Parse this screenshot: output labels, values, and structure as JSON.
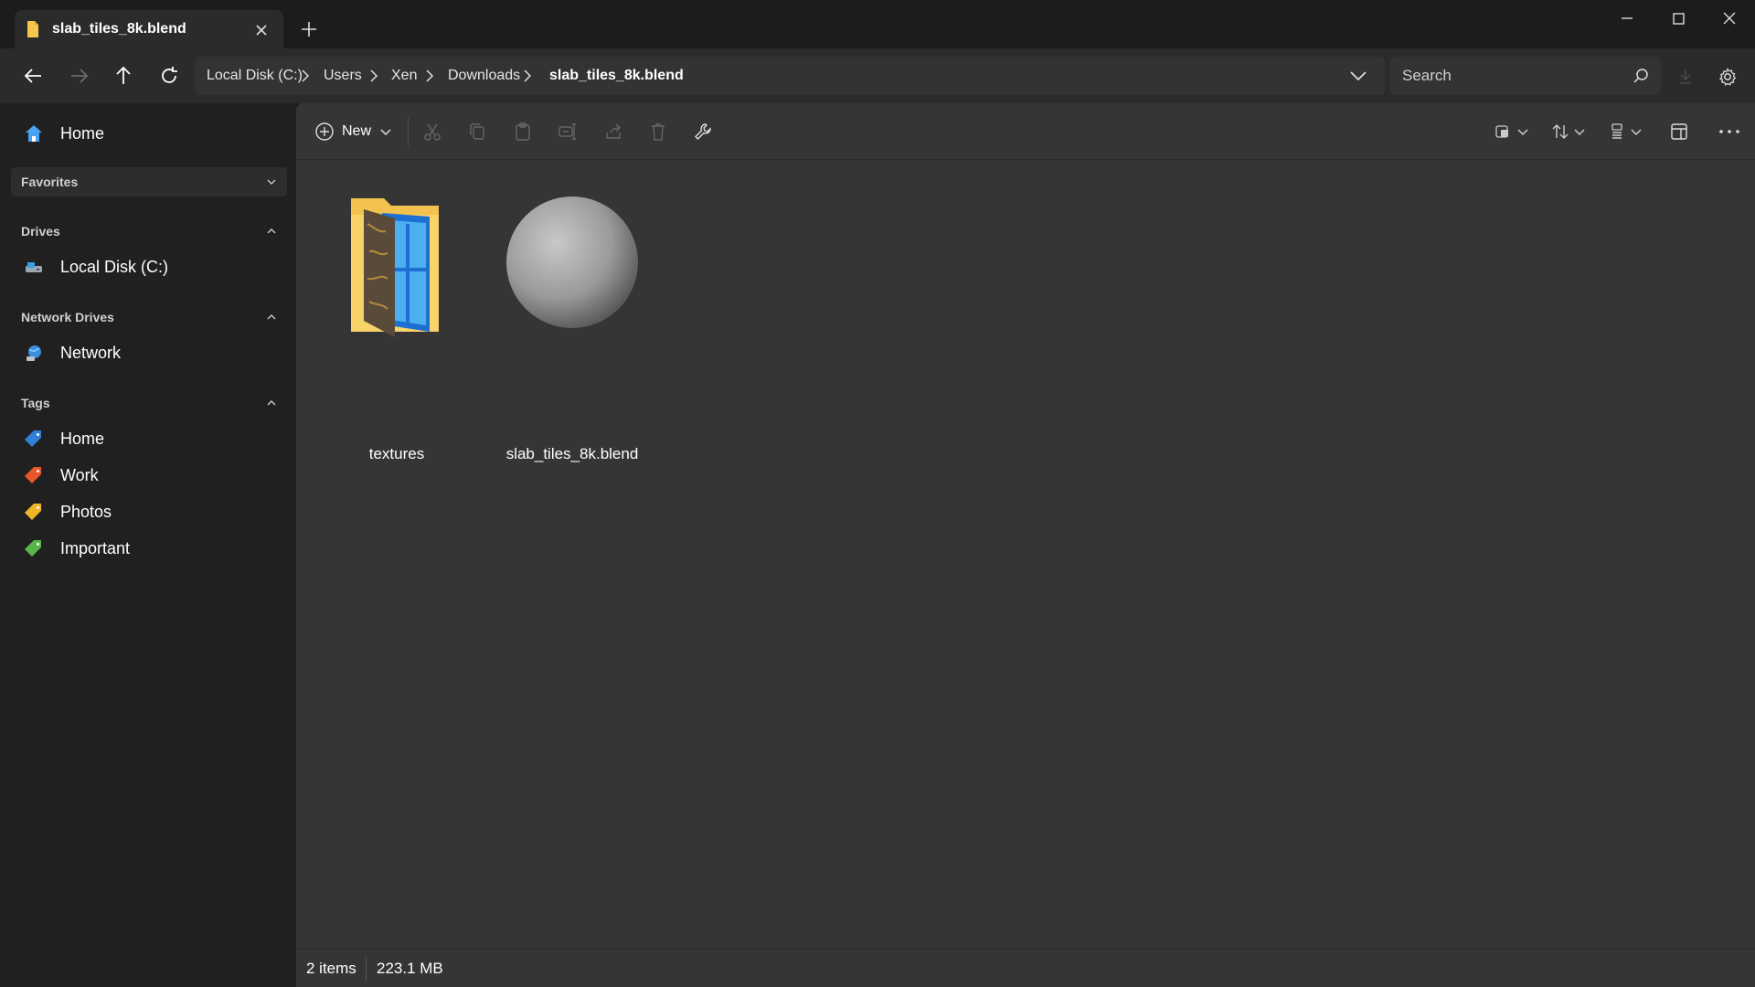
{
  "window": {
    "tab_title": "slab_tiles_8k.blend"
  },
  "breadcrumb": {
    "items": [
      "Local Disk (C:)",
      "Users",
      "Xen",
      "Downloads",
      "slab_tiles_8k.blend"
    ]
  },
  "search": {
    "placeholder": "Search"
  },
  "sidebar": {
    "home_label": "Home",
    "favorites_title": "Favorites",
    "drives_title": "Drives",
    "drives": [
      {
        "label": "Local Disk (C:)",
        "icon": "drive-icon"
      }
    ],
    "network_title": "Network Drives",
    "network": [
      {
        "label": "Network",
        "icon": "network-icon"
      }
    ],
    "tags_title": "Tags",
    "tags": [
      {
        "label": "Home",
        "color": "#2f7fd8",
        "icon": "tag-icon"
      },
      {
        "label": "Work",
        "color": "#e8572a",
        "icon": "tag-icon"
      },
      {
        "label": "Photos",
        "color": "#f0b429",
        "icon": "tag-icon"
      },
      {
        "label": "Important",
        "color": "#58b547",
        "icon": "tag-icon"
      }
    ]
  },
  "toolbar": {
    "new_label": "New"
  },
  "files": [
    {
      "name": "textures",
      "type": "folder",
      "icon": "folder-icon"
    },
    {
      "name": "slab_tiles_8k.blend",
      "type": "blend",
      "icon": "sphere-thumbnail"
    }
  ],
  "status": {
    "item_count": "2 items",
    "total_size": "223.1 MB"
  },
  "colors": {
    "background": "#202020",
    "content": "#353535",
    "accent": "#4cc2ff"
  }
}
